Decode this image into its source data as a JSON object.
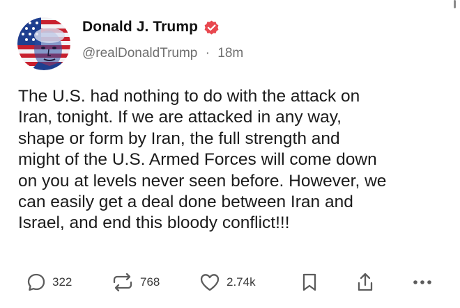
{
  "author": {
    "display_name": "Donald J. Trump",
    "handle": "@realDonaldTrump",
    "separator": "·",
    "timestamp": "18m",
    "verified_icon": "verified-badge-icon",
    "avatar_icon": "profile-avatar"
  },
  "post": {
    "text": "The U.S. had nothing to do with the attack on\nIran, tonight. If we are attacked in any way,\nshape or form by Iran, the full strength and\nmight of the U.S. Armed Forces will come down\non you at levels never seen before. However, we\ncan easily get a deal done between Iran and\nIsrael, and end this bloody conflict!!!"
  },
  "actions": {
    "reply": {
      "icon": "reply-icon",
      "count": "322"
    },
    "retruth": {
      "icon": "repost-icon",
      "count": "768"
    },
    "like": {
      "icon": "heart-icon",
      "count": "2.74k"
    },
    "bookmark": {
      "icon": "bookmark-icon"
    },
    "share": {
      "icon": "share-icon"
    },
    "more": {
      "icon": "more-icon"
    }
  },
  "colors": {
    "text": "#1b1b1b",
    "muted": "#6f6f6f",
    "icon": "#5c5c5c",
    "verified": "#e8484f"
  }
}
